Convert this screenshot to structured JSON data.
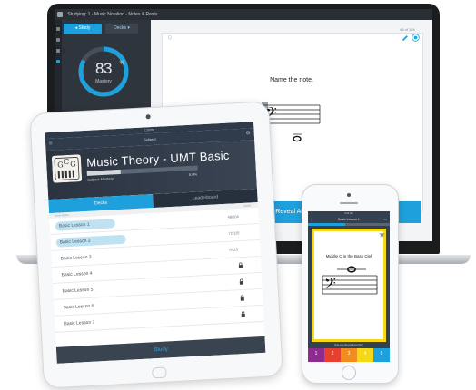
{
  "laptop": {
    "topbar_title": "Studying: 1 - Music Notation - Notes & Rests",
    "study_button": "Study",
    "decks_button": "Decks",
    "mastery_value": "83",
    "mastery_percent_sign": "%",
    "mastery_label": "Mastery",
    "mastery_fraction": 0.83,
    "card_counter": "45 of 104",
    "card_hint": "Q",
    "question": "Name the note.",
    "reveal_button": "Reveal Ans"
  },
  "tablet": {
    "status_bar": "1:29 PM",
    "header_title": "Subject",
    "subject_title": "Music Theory - UMT Basic",
    "subject_mastery_label": "Subject Mastery",
    "subject_mastery_value": "8.0%",
    "subject_mastery_fraction": 0.3,
    "tab_decks": "Decks",
    "tab_leaderboard": "Leaderboard",
    "list_header_left": "Deck Name",
    "list_header_right": "Cards",
    "rows": [
      {
        "label": "Basic Lesson 1",
        "value": "48/104",
        "pill_color": "#bfe2f3",
        "pill_fraction": 0.55
      },
      {
        "label": "Basic Lesson 2",
        "value": "72/115",
        "pill_color": "#bfe2f3",
        "pill_fraction": 0.64
      },
      {
        "label": "Basic Lesson 3",
        "value": "0/115",
        "pill_color": "",
        "pill_fraction": 0
      },
      {
        "label": "Basic Lesson 4",
        "value": "",
        "pill_color": "",
        "pill_fraction": 0
      },
      {
        "label": "Basic Lesson 5",
        "value": "",
        "pill_color": "",
        "pill_fraction": 0
      },
      {
        "label": "Basic Lesson 6",
        "value": "",
        "pill_color": "",
        "pill_fraction": 0
      },
      {
        "label": "Basic Lesson 7",
        "value": "",
        "pill_color": "",
        "pill_fraction": 0
      }
    ],
    "study_button": "Study"
  },
  "phone": {
    "status_bar": "9:41 AM",
    "header_title": "Basic Lesson 1",
    "progress_fraction": 0.45,
    "question": "Middle C in the Bass Clef",
    "footer_text": "How well did you know this?",
    "ratings": [
      {
        "label": "1",
        "color": "#8e2b8e"
      },
      {
        "label": "2",
        "color": "#e8402e"
      },
      {
        "label": "3",
        "color": "#f28c1e"
      },
      {
        "label": "4",
        "color": "#f5d816"
      },
      {
        "label": "5",
        "color": "#1ea0dc"
      }
    ]
  },
  "colors": {
    "accent": "#1ea0dc",
    "dark_panel": "#2f353d",
    "card_border_phone": "#f5d816"
  }
}
